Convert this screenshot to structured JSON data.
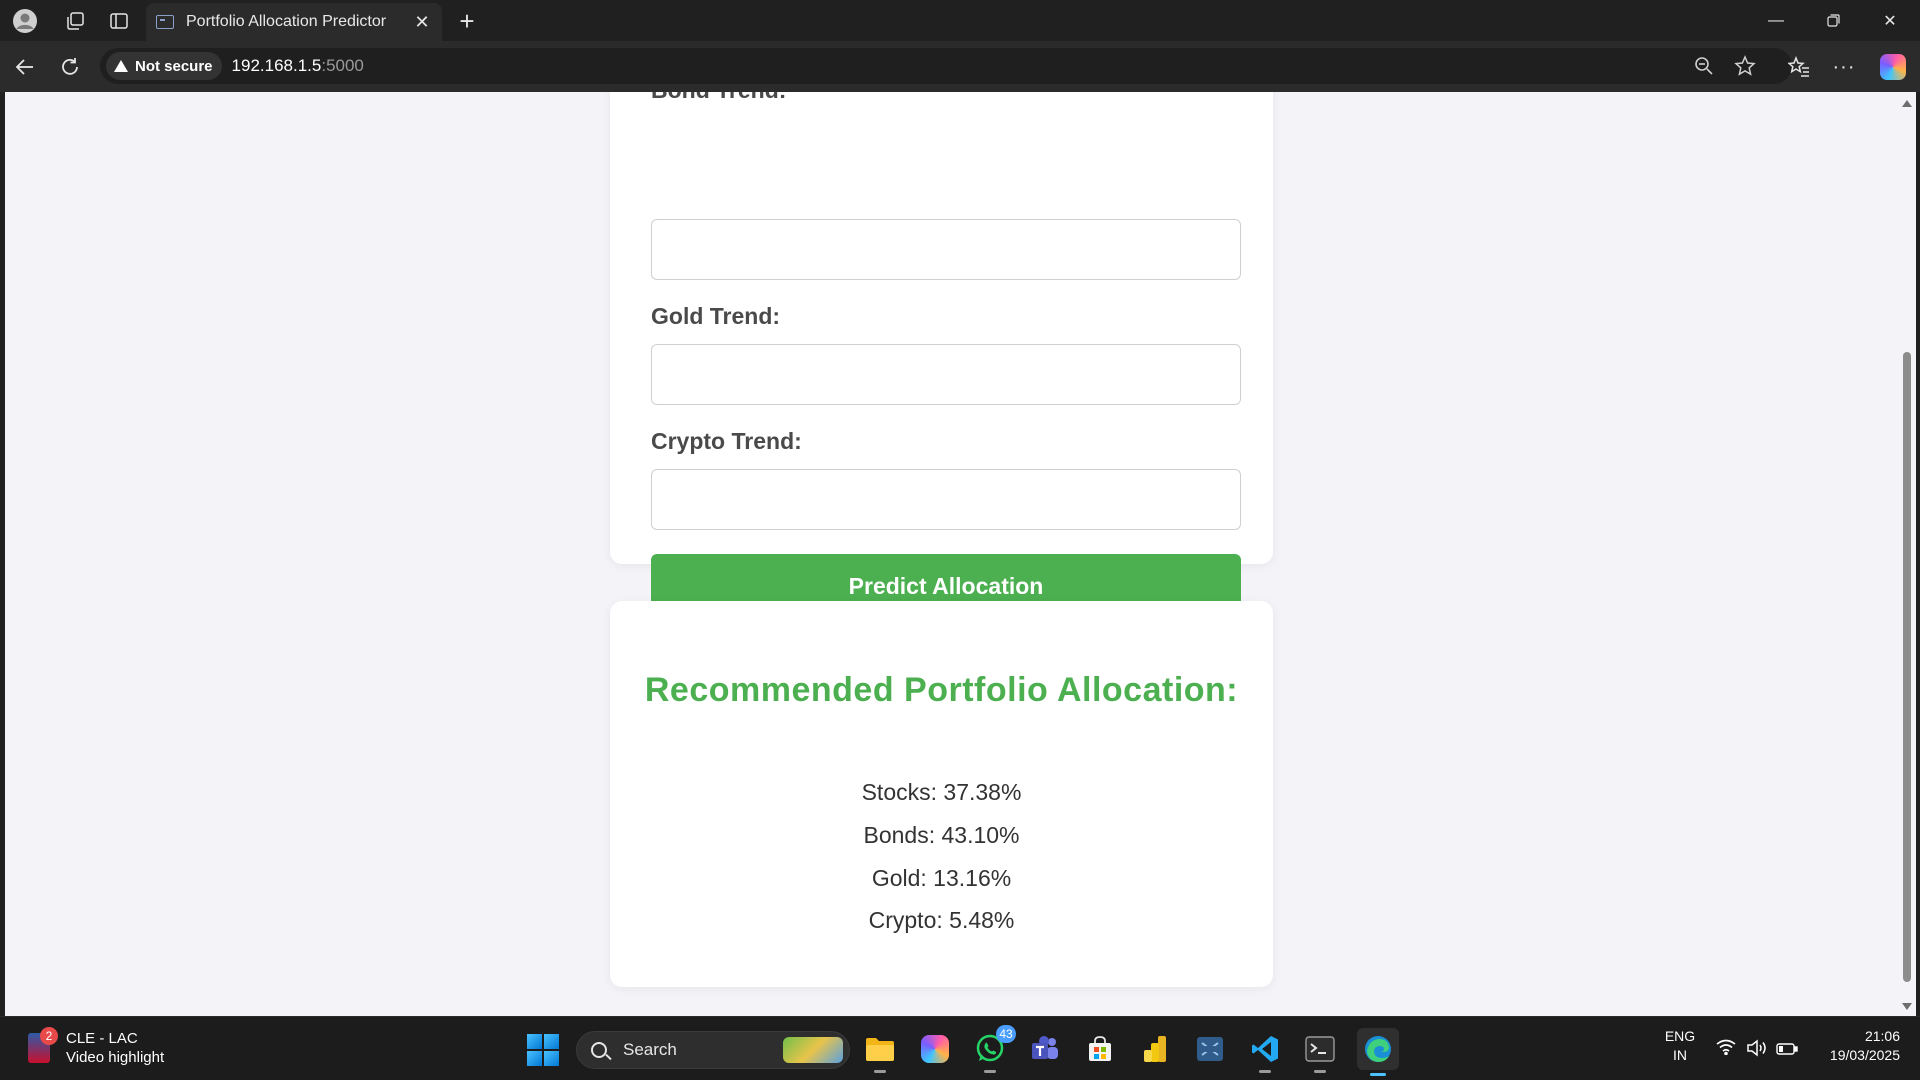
{
  "browser": {
    "tab_title": "Portfolio Allocation Predictor",
    "security_label": "Not secure",
    "url_host": "192.168.1.5",
    "url_port": ":5000"
  },
  "form": {
    "fields": [
      {
        "label": "Bond Trend:",
        "value": ""
      },
      {
        "label": "Gold Trend:",
        "value": ""
      },
      {
        "label": "Crypto Trend:",
        "value": ""
      }
    ],
    "submit_label": "Predict Allocation",
    "accent_color": "#4caf50"
  },
  "result": {
    "title": "Recommended Portfolio Allocation:",
    "lines": [
      "Stocks: 37.38%",
      "Bonds: 43.10%",
      "Gold: 13.16%",
      "Crypto: 5.48%"
    ]
  },
  "taskbar": {
    "widget_title": "CLE - LAC",
    "widget_subtitle": "Video highlight",
    "widget_badge": "2",
    "search_label": "Search",
    "whatsapp_badge": "43",
    "lang_primary": "ENG",
    "lang_secondary": "IN",
    "time": "21:06",
    "date": "19/03/2025"
  }
}
